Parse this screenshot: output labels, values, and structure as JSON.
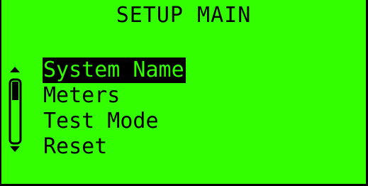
{
  "screen": {
    "title": "SETUP MAIN",
    "colors": {
      "background": "#33ff00",
      "foreground": "#000000"
    }
  },
  "menu": {
    "items": [
      {
        "label": "System Name",
        "selected": true
      },
      {
        "label": "Meters",
        "selected": false
      },
      {
        "label": "Test Mode",
        "selected": false
      },
      {
        "label": "Reset",
        "selected": false
      }
    ]
  },
  "scrollbar": {
    "up_icon": "arrow-up-icon",
    "down_icon": "arrow-down-icon",
    "position": 0.0
  }
}
